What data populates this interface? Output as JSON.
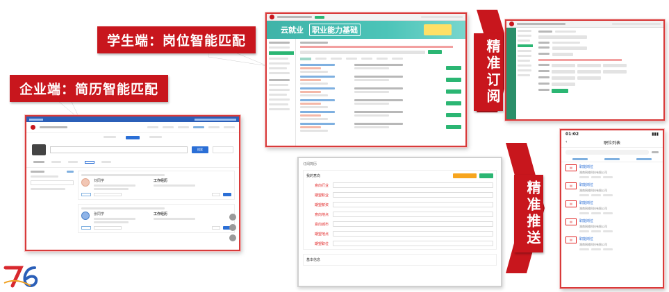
{
  "callouts": {
    "student": "学生端：岗位智能匹配",
    "enterprise": "企业端：简历智能匹配",
    "subscribe": "精准订阅",
    "push": "精准推送"
  },
  "colors": {
    "brand_red": "#c8161d",
    "green": "#2bb673",
    "blue": "#2b6fd6",
    "teal": "#3fb3a8"
  },
  "student_screen": {
    "banner_text_1": "云就业",
    "banner_text_2": "职业能力基础"
  },
  "subscribe_form": {
    "title": "订阅简历",
    "section_label": "我的意向",
    "fields": [
      "意向行业",
      "期望职业",
      "期望薪资",
      "意向地点",
      "意向城市",
      "期望地点",
      "期望职位"
    ],
    "section2": "基本信息"
  },
  "mobile": {
    "time": "01:02",
    "title": "职位列表",
    "jobs": [
      {
        "title": "职能岗位",
        "company": "湖南网络科技有限公司"
      },
      {
        "title": "职能岗位",
        "company": "湖南网络科技有限公司"
      },
      {
        "title": "职能岗位",
        "company": "湖南网络科技有限公司"
      },
      {
        "title": "职能岗位",
        "company": "湖南网络科技有限公司"
      },
      {
        "title": "职能岗位",
        "company": "湖南网络科技有限公司"
      }
    ]
  },
  "enterprise_screen": {
    "search_button": "搜索",
    "candidates": [
      {
        "name": "刘同学",
        "job": "工作经历"
      },
      {
        "name": "张同学",
        "job": "工作经历"
      }
    ]
  }
}
